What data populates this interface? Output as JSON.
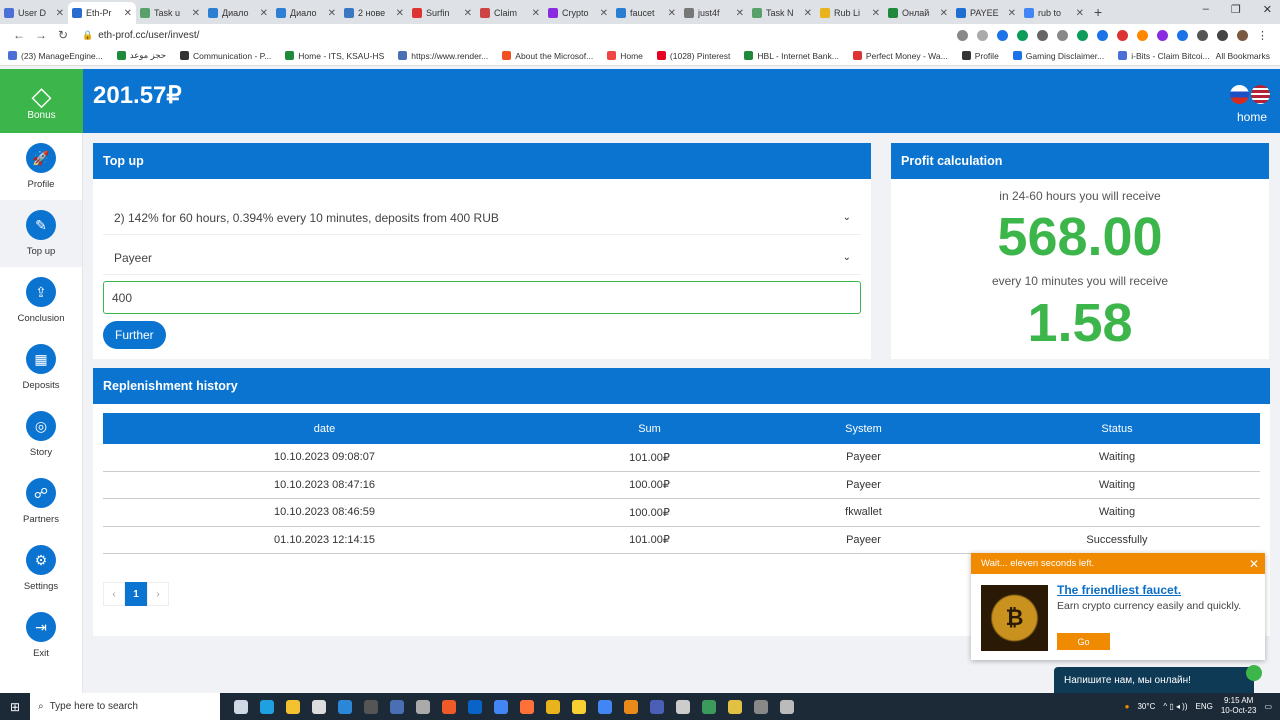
{
  "browser": {
    "tabs": [
      {
        "label": "User D",
        "color": "#4a6fd6"
      },
      {
        "label": "Eth-Pr",
        "color": "#2a6bd1",
        "active": true
      },
      {
        "label": "Task u",
        "color": "#5aa06a"
      },
      {
        "label": "Диало",
        "color": "#2d7fd3"
      },
      {
        "label": "Диало",
        "color": "#2d7fd3"
      },
      {
        "label": "2 нове",
        "color": "#3b78c4"
      },
      {
        "label": "Surfin",
        "color": "#d33"
      },
      {
        "label": "Claim",
        "color": "#c44"
      },
      {
        "label": "Crypto",
        "color": "#8a2be2"
      },
      {
        "label": "faucet",
        "color": "#2a7fd0"
      },
      {
        "label": "just4f",
        "color": "#777"
      },
      {
        "label": "Task N",
        "color": "#5aa06a"
      },
      {
        "label": "Rub Li",
        "color": "#e9b31c"
      },
      {
        "label": "Онлай",
        "color": "#1e8a3a"
      },
      {
        "label": "PAYEE",
        "color": "#1e6fd0"
      },
      {
        "label": "rub to",
        "color": "#4285f4"
      }
    ],
    "url": "eth-prof.cc/user/invest/",
    "bookmarks": [
      "(23) ManageEngine...",
      "حجز موعد",
      "Communication - P...",
      "Home - ITS, KSAU-HS",
      "https://www.render...",
      "About the Microsof...",
      "Home",
      "(1028) Pinterest",
      "HBL - Internet Bank...",
      "Perfect Money - Wa...",
      "Profile",
      "Gaming Disclaimer...",
      "i-Bits - Claim Bitcoi..."
    ],
    "all_bookmarks": "All Bookmarks"
  },
  "sidebar": {
    "bonus_label": "Bonus",
    "items": [
      {
        "label": "Profile",
        "icon": "rocket-icon",
        "glyph": "🚀"
      },
      {
        "label": "Top up",
        "icon": "top-up-icon",
        "glyph": "✎"
      },
      {
        "label": "Conclusion",
        "icon": "conclusion-icon",
        "glyph": "⇪"
      },
      {
        "label": "Deposits",
        "icon": "deposits-icon",
        "glyph": "▦"
      },
      {
        "label": "Story",
        "icon": "story-icon",
        "glyph": "◎"
      },
      {
        "label": "Partners",
        "icon": "partners-icon",
        "glyph": "☍"
      },
      {
        "label": "Settings",
        "icon": "settings-icon",
        "glyph": "⚙"
      },
      {
        "label": "Exit",
        "icon": "exit-icon",
        "glyph": "⇥"
      }
    ]
  },
  "header": {
    "balance": "201.57₽",
    "home_label": "home"
  },
  "topup": {
    "title": "Top up",
    "plan_select": "2) 142% for 60 hours, 0.394% every 10 minutes, deposits from 400 RUB",
    "system_select": "Payeer",
    "amount_value": "400",
    "further_label": "Further"
  },
  "profit": {
    "title": "Profit calculation",
    "total_caption": "in 24-60 hours you will receive",
    "total_value": "568.00",
    "interval_caption": "every 10 minutes you will receive",
    "interval_value": "1.58"
  },
  "history": {
    "title": "Replenishment history",
    "columns": [
      "date",
      "Sum",
      "System",
      "Status"
    ],
    "rows": [
      [
        "10.10.2023 09:08:07",
        "101.00₽",
        "Payeer",
        "Waiting"
      ],
      [
        "10.10.2023 08:47:16",
        "100.00₽",
        "Payeer",
        "Waiting"
      ],
      [
        "10.10.2023 08:46:59",
        "100.00₽",
        "fkwallet",
        "Waiting"
      ],
      [
        "01.10.2023 12:14:15",
        "101.00₽",
        "Payeer",
        "Successfully"
      ]
    ],
    "pager": {
      "prev": "‹",
      "current": "1",
      "next": "›"
    }
  },
  "popup": {
    "header": "Wait... eleven seconds left.",
    "title": "The friendliest faucet.",
    "description": "Earn crypto currency easily and quickly.",
    "go_label": "Go"
  },
  "chat": {
    "label": "Напишите нам, мы онлайн!"
  },
  "taskbar": {
    "search_placeholder": "Type here to search",
    "temperature": "30°C",
    "language": "ENG",
    "time": "9:15 AM",
    "date": "10-Oct-23"
  },
  "colors": {
    "primary": "#0a74d0",
    "accent_green": "#3cb54a",
    "popup_orange": "#f08a00"
  }
}
